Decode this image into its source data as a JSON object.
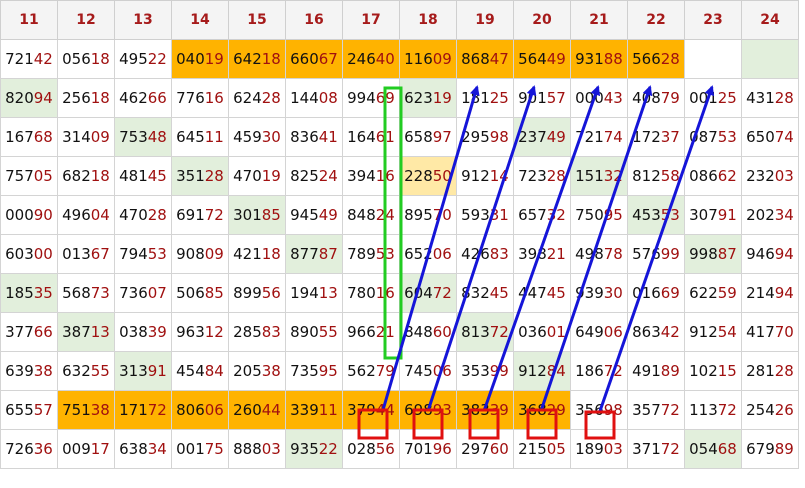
{
  "columns": [
    "11",
    "12",
    "13",
    "14",
    "15",
    "16",
    "17",
    "18",
    "19",
    "20",
    "21",
    "22",
    "23",
    "24"
  ],
  "rows": [
    [
      "72142",
      "05618",
      "49522",
      "04019",
      "64218",
      "66067",
      "24640",
      "11609",
      "86847",
      "56449",
      "93188",
      "56628",
      "",
      ""
    ],
    [
      "82094",
      "25618",
      "46266",
      "77616",
      "62428",
      "14408",
      "99469",
      "62319",
      "18125",
      "90157",
      "00043",
      "40879",
      "00125",
      "43128"
    ],
    [
      "16768",
      "31409",
      "75348",
      "64511",
      "45930",
      "83641",
      "16461",
      "65897",
      "29598",
      "23749",
      "72174",
      "17237",
      "08753",
      "65074"
    ],
    [
      "75705",
      "68218",
      "48145",
      "35128",
      "47019",
      "82524",
      "39416",
      "22850",
      "91214",
      "72328",
      "15132",
      "81258",
      "08662",
      "23203"
    ],
    [
      "00090",
      "49604",
      "47028",
      "69172",
      "30185",
      "94549",
      "84824",
      "89570",
      "59331",
      "65732",
      "75095",
      "45353",
      "30791",
      "20234"
    ],
    [
      "60300",
      "01367",
      "79453",
      "90809",
      "42118",
      "87787",
      "78953",
      "65206",
      "42683",
      "39821",
      "49878",
      "57699",
      "99887",
      "94694"
    ],
    [
      "18535",
      "56873",
      "73607",
      "50685",
      "89956",
      "19413",
      "78016",
      "60472",
      "83245",
      "44745",
      "93930",
      "01669",
      "62259",
      "21494"
    ],
    [
      "37766",
      "38713",
      "03839",
      "96312",
      "28583",
      "89055",
      "96621",
      "84860",
      "81372",
      "03601",
      "64906",
      "86342",
      "91254",
      "41770"
    ],
    [
      "63938",
      "63255",
      "31391",
      "45484",
      "20538",
      "73595",
      "56279",
      "74506",
      "35399",
      "91284",
      "18672",
      "49189",
      "10215",
      "28128"
    ],
    [
      "65557",
      "75138",
      "17172",
      "80606",
      "26044",
      "33911",
      "37944",
      "69893",
      "38339",
      "36829",
      "35698",
      "35772",
      "11372",
      "25426"
    ],
    [
      "72636",
      "00917",
      "63834",
      "00175",
      "88803",
      "93522",
      "02856",
      "70196",
      "29760",
      "21505",
      "18903",
      "37172",
      "05468",
      "67989"
    ]
  ],
  "highlights": {
    "orange": [
      [
        0,
        3
      ],
      [
        0,
        4
      ],
      [
        0,
        5
      ],
      [
        0,
        6
      ],
      [
        0,
        7
      ],
      [
        0,
        8
      ],
      [
        0,
        9
      ],
      [
        0,
        10
      ],
      [
        0,
        11
      ],
      [
        9,
        1
      ],
      [
        9,
        2
      ],
      [
        9,
        3
      ],
      [
        9,
        4
      ],
      [
        9,
        5
      ],
      [
        9,
        6
      ],
      [
        9,
        7
      ],
      [
        9,
        8
      ],
      [
        9,
        9
      ]
    ],
    "green": [
      [
        0,
        13
      ],
      [
        1,
        0
      ],
      [
        1,
        7
      ],
      [
        2,
        2
      ],
      [
        2,
        9
      ],
      [
        3,
        3
      ],
      [
        3,
        10
      ],
      [
        4,
        4
      ],
      [
        4,
        11
      ],
      [
        5,
        5
      ],
      [
        5,
        12
      ],
      [
        6,
        0
      ],
      [
        6,
        7
      ],
      [
        7,
        1
      ],
      [
        7,
        8
      ],
      [
        8,
        2
      ],
      [
        8,
        9
      ],
      [
        10,
        5
      ],
      [
        10,
        12
      ]
    ],
    "yellow": [
      [
        3,
        7
      ]
    ]
  },
  "annotation_color": "#1515d8",
  "box_color": "#e01010",
  "green_box_color": "#22cc22"
}
